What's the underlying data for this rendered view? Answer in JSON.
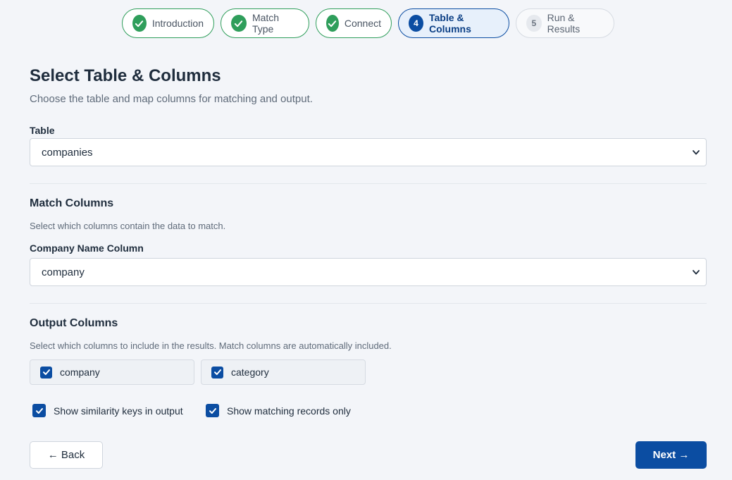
{
  "stepper": {
    "steps": [
      {
        "label": "Introduction",
        "state": "done",
        "badge": ""
      },
      {
        "label": "Match Type",
        "state": "done",
        "badge": ""
      },
      {
        "label": "Connect",
        "state": "done",
        "badge": ""
      },
      {
        "label": "Table & Columns",
        "state": "active",
        "badge": "4"
      },
      {
        "label": "Run & Results",
        "state": "pending",
        "badge": "5"
      }
    ]
  },
  "page": {
    "title": "Select Table & Columns",
    "subtitle": "Choose the table and map columns for matching and output."
  },
  "table_field": {
    "label": "Table",
    "value": "companies"
  },
  "match_columns": {
    "title": "Match Columns",
    "description": "Select which columns contain the data to match.",
    "company_name": {
      "label": "Company Name Column",
      "value": "company"
    }
  },
  "output_columns": {
    "title": "Output Columns",
    "description": "Select which columns to include in the results. Match columns are automatically included.",
    "columns": [
      {
        "label": "company",
        "checked": true
      },
      {
        "label": "category",
        "checked": true
      }
    ]
  },
  "options": {
    "show_similarity_keys": {
      "label": "Show similarity keys in output",
      "checked": true
    },
    "show_matching_only": {
      "label": "Show matching records only",
      "checked": true
    }
  },
  "nav": {
    "back_label": "← Back",
    "next_label": "Next →"
  },
  "colors": {
    "accent": "#0b4da2",
    "success": "#2f9e5b",
    "background": "#f3f5f9"
  }
}
